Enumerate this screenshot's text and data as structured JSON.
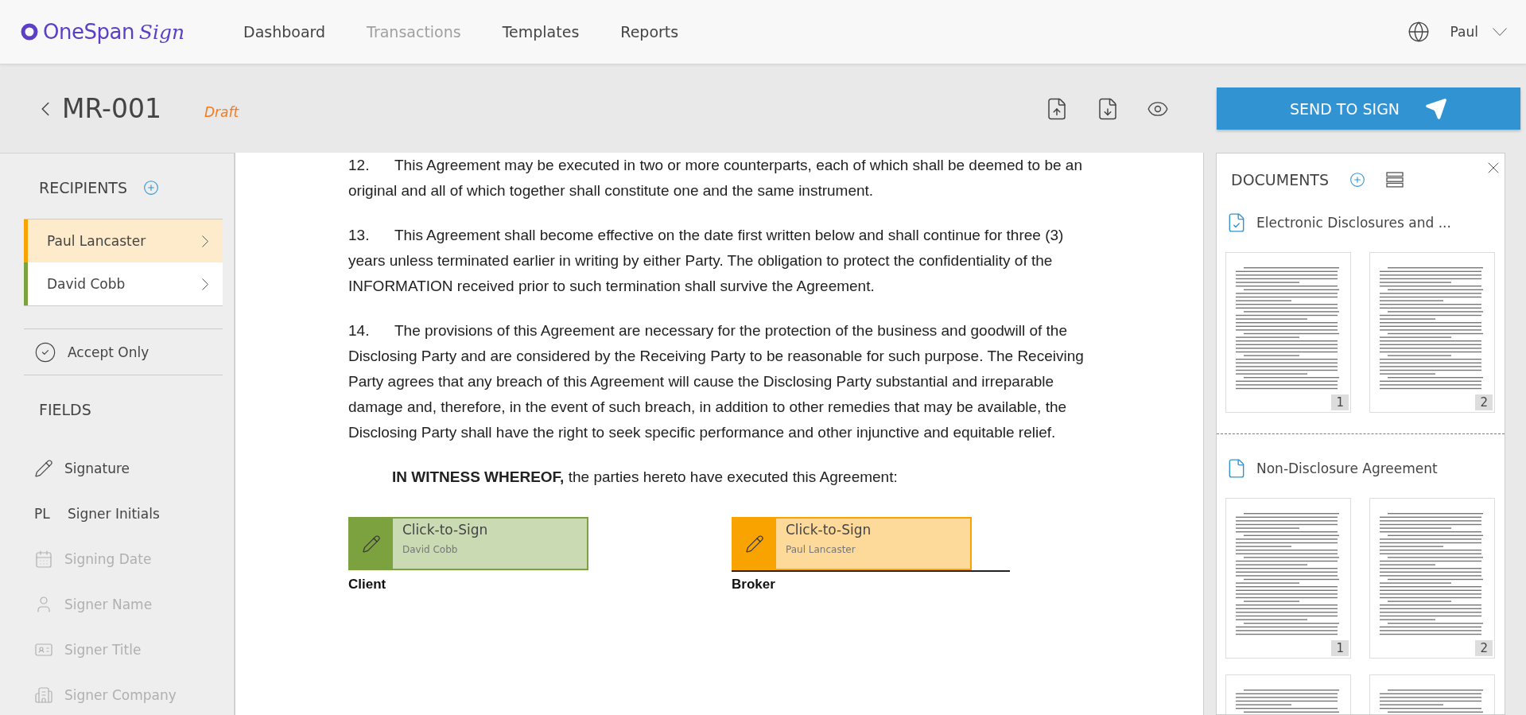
{
  "header": {
    "logo": {
      "word": "OneSpan",
      "script": "Sign"
    },
    "nav": [
      {
        "label": "Dashboard",
        "selected": false
      },
      {
        "label": "Transactions",
        "selected": true
      },
      {
        "label": "Templates",
        "selected": false
      },
      {
        "label": "Reports",
        "selected": false
      }
    ],
    "user": "Paul"
  },
  "transaction": {
    "title": "MR-001",
    "status": "Draft",
    "send_button": "SEND TO SIGN"
  },
  "sidebar": {
    "recipients_heading": "RECIPIENTS",
    "recipients": [
      {
        "name": "Paul Lancaster",
        "color": "#f9a300",
        "selected": true
      },
      {
        "name": "David Cobb",
        "color": "#7ba23f",
        "selected": false
      }
    ],
    "accept_only": "Accept Only",
    "fields_heading": "FIELDS",
    "fields": [
      {
        "kind": "signature",
        "label": "Signature",
        "disabled": false
      },
      {
        "kind": "initials",
        "badge": "PL",
        "label": "Signer Initials",
        "disabled": false
      },
      {
        "kind": "date",
        "label": "Signing Date",
        "disabled": true
      },
      {
        "kind": "name",
        "label": "Signer Name",
        "disabled": true
      },
      {
        "kind": "title",
        "label": "Signer Title",
        "disabled": true
      },
      {
        "kind": "company",
        "label": "Signer Company",
        "disabled": true
      }
    ]
  },
  "document": {
    "paragraphs": [
      {
        "kind": "numbered",
        "number": "12.",
        "text": "This Agreement may be executed in two or more counterparts, each of which shall be deemed to be an original and all of which together shall constitute one and the same instrument."
      },
      {
        "kind": "numbered",
        "number": "13.",
        "text": "This Agreement shall become effective on the date first written below and shall continue for three (3) years unless terminated earlier in writing by either Party. The obligation to protect the confidentiality of the INFORMATION received prior to such termination shall survive the Agreement."
      },
      {
        "kind": "numbered",
        "number": "14.",
        "text": "The provisions of this Agreement are necessary for the protection of the business and goodwill of the Disclosing Party and are considered by the Receiving Party to be reasonable for such purpose. The Receiving Party agrees that any breach of this Agreement will cause the Disclosing Party substantial and irreparable damage and, therefore, in the event of such breach, in addition to other remedies that may be available, the Disclosing Party shall have the right to seek specific performance and other injunctive and equitable relief."
      },
      {
        "kind": "indented",
        "text": "**IN WITNESS WHEREOF,** the parties hereto have executed this Agreement:"
      }
    ],
    "signatures": [
      {
        "label": "Click-to-Sign",
        "signer": "David Cobb",
        "caption": "Client",
        "color": "#7ba23f",
        "underline": false
      },
      {
        "label": "Click-to-Sign",
        "signer": "Paul Lancaster",
        "caption": "Broker",
        "color": "#f9a300",
        "underline": true
      }
    ]
  },
  "documents_panel": {
    "heading": "DOCUMENTS",
    "documents": [
      {
        "kind": "disclosure",
        "title": "Electronic Disclosures and ...",
        "pages": [
          {
            "kind": "full",
            "number": "1"
          },
          {
            "kind": "full",
            "number": "2"
          }
        ]
      },
      {
        "kind": "plain",
        "title": "Non-Disclosure Agreement",
        "pages": [
          {
            "kind": "full",
            "number": "1"
          },
          {
            "kind": "full",
            "number": "2"
          },
          {
            "kind": "partial"
          },
          {
            "kind": "partial"
          }
        ]
      }
    ]
  }
}
